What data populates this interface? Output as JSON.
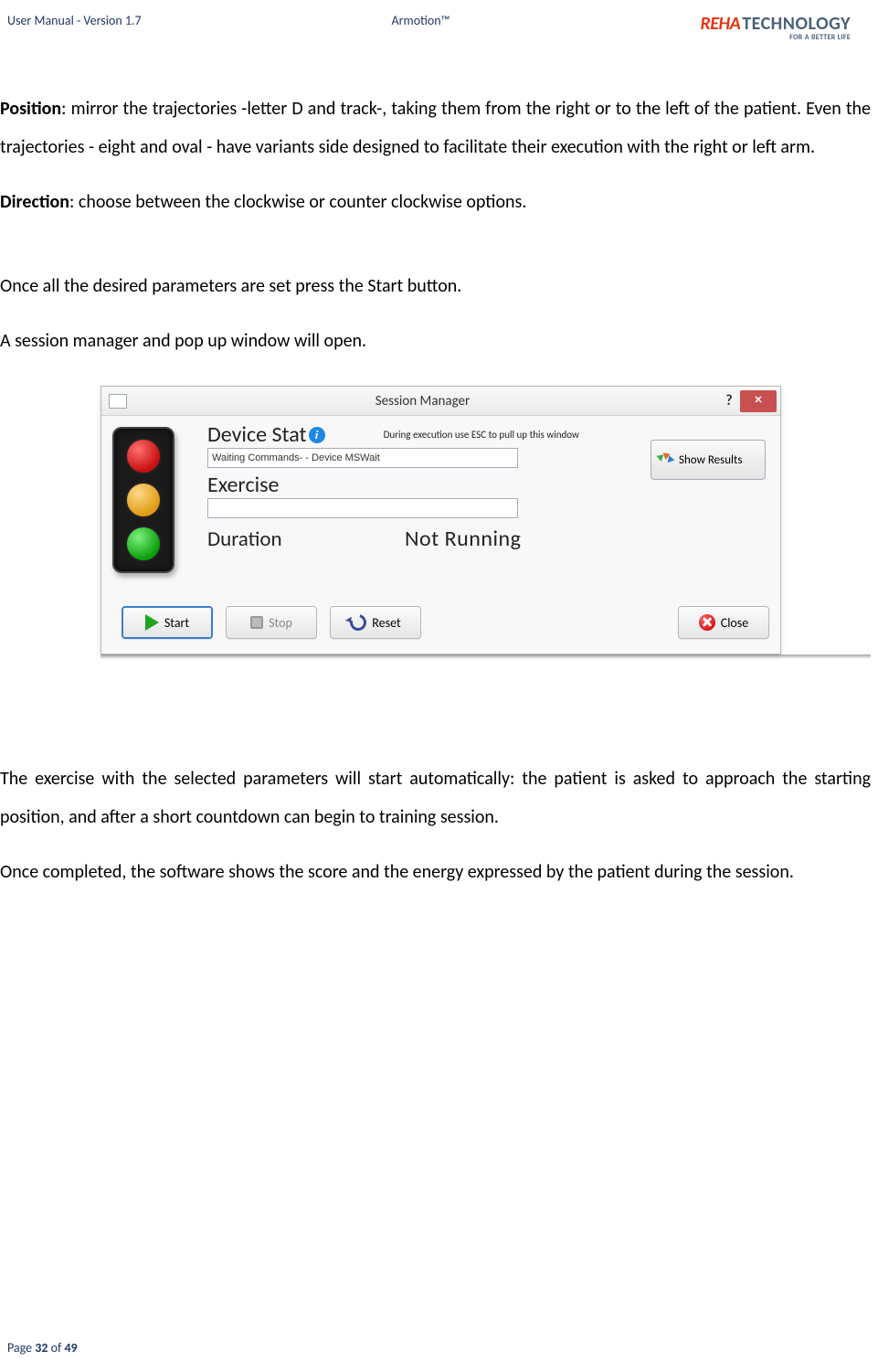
{
  "header": {
    "left": "User Manual - Version 1.7",
    "center": "Armotion™",
    "logo_reha": "REHA",
    "logo_tech": "TECHNOLOGY",
    "logo_sub": "FOR A BETTER LIFE"
  },
  "body": {
    "position_label": "Position",
    "position_text": ": mirror the trajectories -letter D and track-, taking them from the right or to the left of the patient. Even the trajectories - eight and oval - have variants side designed to facilitate their execution with the right or left arm.",
    "direction_label": "Direction",
    "direction_text": ": choose between the clockwise or counter clockwise options.",
    "para3": "Once all the desired parameters are set press the Start button.",
    "para4": "A session manager and pop up window will open.",
    "para5": "The exercise with the selected parameters will start automatically: the patient is asked to approach the starting position, and after a short countdown can begin to training session.",
    "para6": "Once completed, the software shows the score and the energy expressed by the patient during the session."
  },
  "dialog": {
    "title": "Session Manager",
    "help_symbol": "?",
    "close_symbol": "×",
    "device_state_label": "Device Stat",
    "esc_note": "During execution use ESC to pull up this window",
    "status_text": "Waiting Commands- - Device MSWait",
    "exercise_label": "Exercise",
    "exercise_value": "",
    "duration_label": "Duration",
    "duration_value": "Not Running",
    "show_results": "Show Results",
    "start": "Start",
    "stop": "Stop",
    "reset": "Reset",
    "close": "Close"
  },
  "footer": {
    "prefix": "Page ",
    "current": "32",
    "of": " of ",
    "total": "49"
  }
}
